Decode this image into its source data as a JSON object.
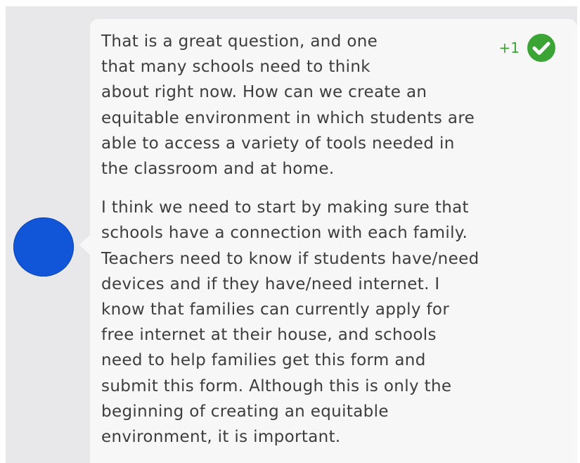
{
  "post": {
    "vote_count": "+1",
    "accent_color": "#3aa535",
    "avatar_color": "#1155d9",
    "icon": "check-circle-icon",
    "paragraphs": [
      "That is a great question, and one\nthat many schools need to think\nabout right now. How can we create an\nequitable environment in which students are\nable to access a variety of tools needed in\nthe classroom and at home.",
      "I think we need to start by making sure that\nschools have a connection with each family.\nTeachers need to know if students have/need\ndevices and if they have/need internet. I\nknow that families can currently apply for\nfree internet at their house, and schools\nneed to help families get this form and\nsubmit this form. Although this is only the\nbeginning of creating an equitable\nenvironment, it is important."
    ]
  }
}
